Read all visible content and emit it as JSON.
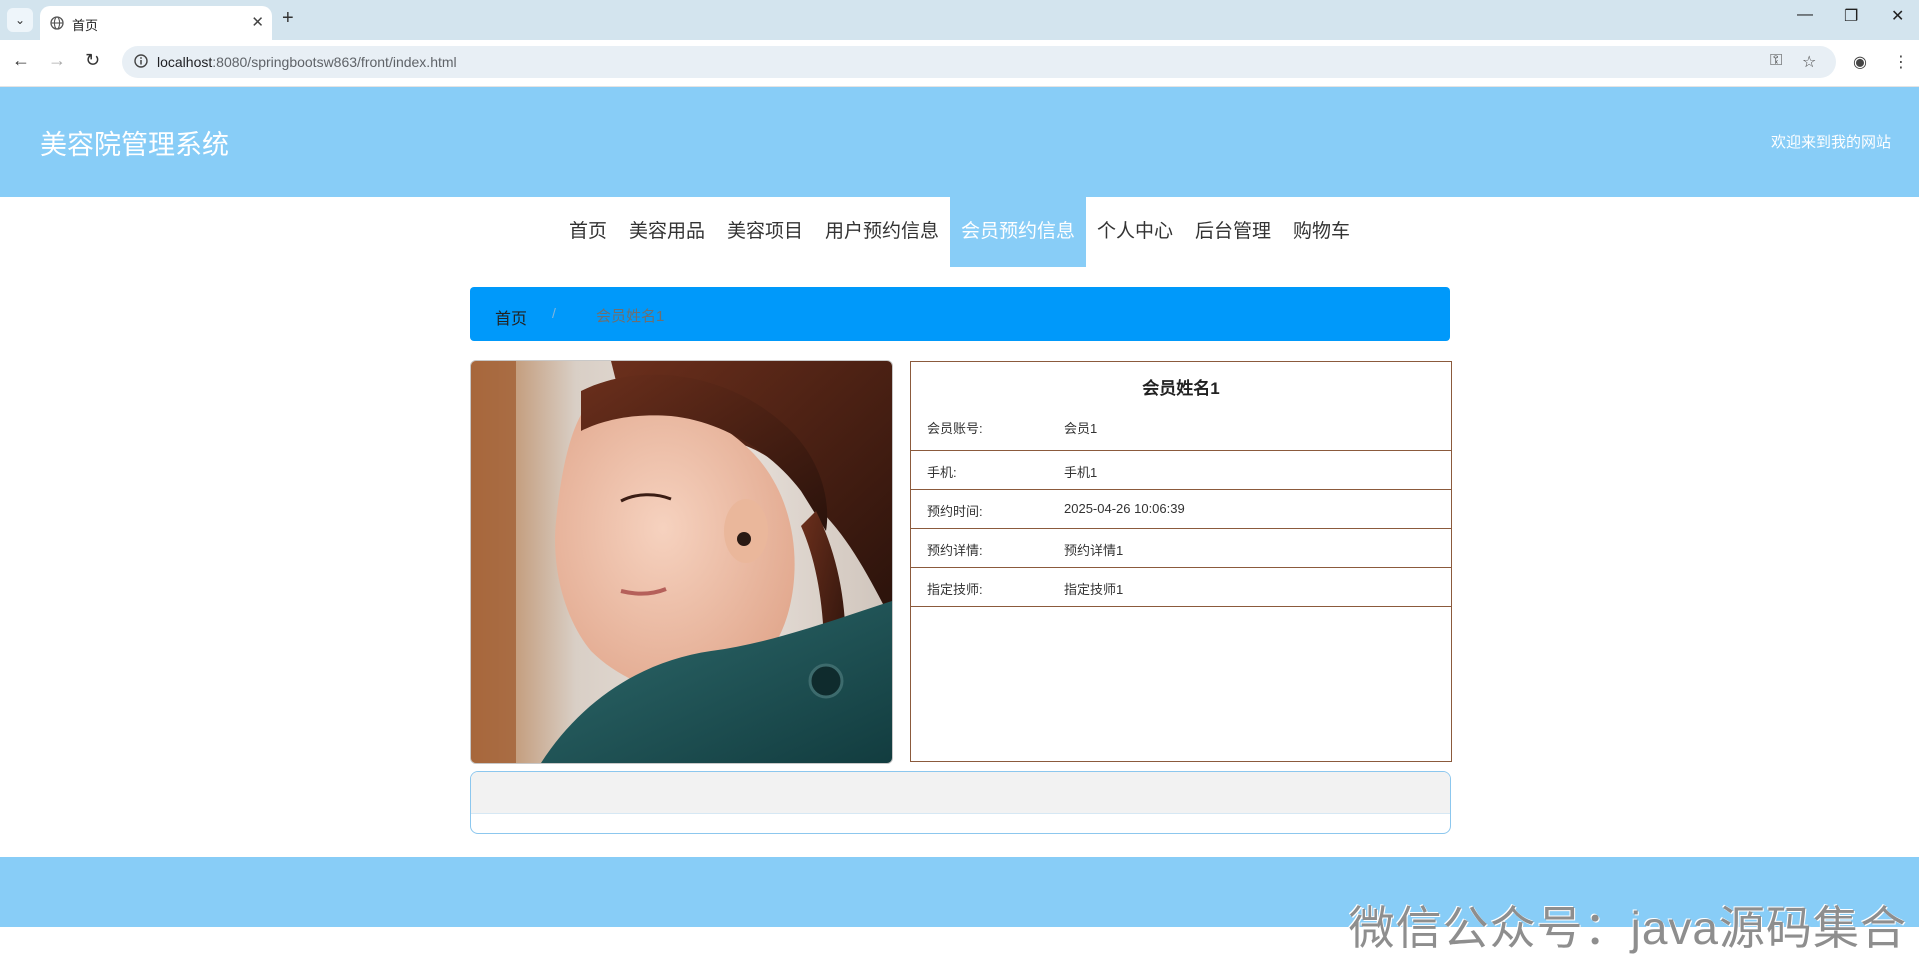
{
  "browser": {
    "tab_title": "首页",
    "url_host": "localhost",
    "url_path": ":8080/springbootsw863/front/index.html"
  },
  "header": {
    "site_title": "美容院管理系统",
    "welcome": "欢迎来到我的网站"
  },
  "nav": {
    "items": [
      "首页",
      "美容用品",
      "美容项目",
      "用户预约信息",
      "会员预约信息",
      "个人中心",
      "后台管理",
      "购物车"
    ],
    "active_index": 4
  },
  "breadcrumb": {
    "home": "首页",
    "separator": "/",
    "current": "会员姓名1"
  },
  "detail": {
    "title": "会员姓名1",
    "rows": [
      {
        "label": "会员账号:",
        "value": "会员1"
      },
      {
        "label": "手机:",
        "value": "手机1"
      },
      {
        "label": "预约时间:",
        "value": "2025-04-26 10:06:39"
      },
      {
        "label": "预约详情:",
        "value": "预约详情1"
      },
      {
        "label": "指定技师:",
        "value": "指定技师1"
      }
    ]
  },
  "watermark": "微信公众号：java源码集合",
  "colors": {
    "header_bg": "#88cdf7",
    "breadcrumb_bg": "#0099fa",
    "detail_border": "#8b5a3c"
  },
  "icons": {
    "tab_favicon": "globe-icon",
    "back": "arrow-left-icon",
    "forward": "arrow-right-icon",
    "reload": "reload-icon",
    "site_info": "info-icon",
    "password": "key-icon",
    "bookmark": "star-icon",
    "profile": "profile-icon",
    "menu": "kebab-menu-icon"
  }
}
